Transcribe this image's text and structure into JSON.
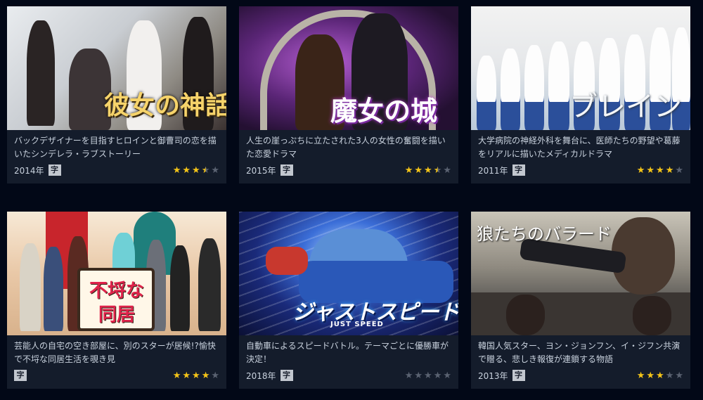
{
  "cards": [
    {
      "thumb_title": "彼女の神話",
      "description": "バックデザイナーを目指すヒロインと御曹司の恋を描いたシンデレラ・ラブストーリー",
      "year": "2014年",
      "sub": "字",
      "rating": 3.5
    },
    {
      "thumb_title": "魔女の城",
      "description": "人生の崖っぷちに立たされた3人の女性の奮闘を描いた恋愛ドラマ",
      "year": "2015年",
      "sub": "字",
      "rating": 3.5
    },
    {
      "thumb_title": "ブレイン",
      "description": "大学病院の神経外科を舞台に、医師たちの野望や葛藤をリアルに描いたメディカルドラマ",
      "year": "2011年",
      "sub": "字",
      "rating": 4
    },
    {
      "thumb_title": "不埒な同居",
      "description": "芸能人の自宅の空き部屋に、別のスターが居候!?愉快で不埒な同居生活を覗き見",
      "year": "",
      "sub": "字",
      "rating": 4
    },
    {
      "thumb_title": "ジャストスピード",
      "thumb_subtitle": "JUST SPEED",
      "description": "自動車によるスピードバトル。テーマごとに優勝車が決定！",
      "year": "2018年",
      "sub": "字",
      "rating": 0
    },
    {
      "thumb_title": "狼たちのバラード",
      "description": "韓国人気スター、ヨン・ジョンフン、イ・ジフン共演で贈る、悲しき報復が連鎖する物語",
      "year": "2013年",
      "sub": "字",
      "rating": 3
    }
  ],
  "colors": {
    "background": "#020817",
    "card": "#141c2b",
    "star_on": "#f5c518",
    "star_off": "#5a6271"
  },
  "icons": {
    "star": "star-icon"
  }
}
